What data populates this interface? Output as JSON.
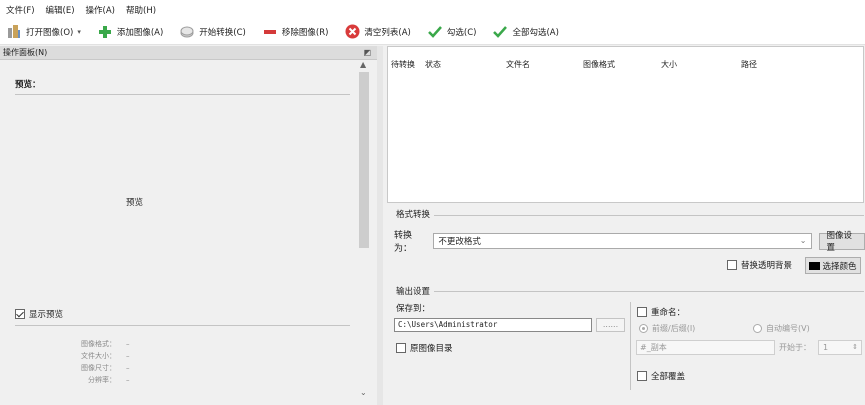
{
  "menubar": {
    "items": [
      "文件(F)",
      "编辑(E)",
      "操作(A)",
      "帮助(H)"
    ]
  },
  "toolbar": {
    "open_image": "打开图像(O)",
    "add_image": "添加图像(A)",
    "start_convert": "开始转换(C)",
    "remove_image": "移除图像(R)",
    "clear_list": "清空列表(A)",
    "check": "勾选(C)",
    "check_all": "全部勾选(A)"
  },
  "left_panel": {
    "header": "操作面板(N)",
    "preview_label": "预览：",
    "preview_placeholder": "预览",
    "show_preview": "显示预览",
    "info": [
      {
        "key": "图像格式：",
        "value": "–"
      },
      {
        "key": "文件大小：",
        "value": "–"
      },
      {
        "key": "图像尺寸：",
        "value": "–"
      },
      {
        "key": "分辨率：",
        "value": "–"
      }
    ]
  },
  "file_list": {
    "columns": [
      "待转换",
      "状态",
      "文件名",
      "图像格式",
      "大小",
      "路径"
    ]
  },
  "format_convert": {
    "title": "格式转换",
    "convert_to_label": "转换为：",
    "convert_to_value": "不更改格式",
    "image_settings_button": "图像设置",
    "replace_transparent": "替换透明背景",
    "select_color_button": "选择颜色",
    "swatch_color": "#000000"
  },
  "output": {
    "title": "输出设置",
    "save_to_label": "保存到：",
    "save_path": "C:\\Users\\Administrator",
    "browse_button": "......",
    "source_dir": "原图像目录",
    "rename_label": "重命名：",
    "prefix_suffix": "前缀/后缀(I)",
    "auto_number": "自动编号(V)",
    "name_pattern": "#_副本",
    "start_at_label": "开始于：",
    "start_at_value": "1",
    "overwrite_all": "全部覆盖"
  }
}
